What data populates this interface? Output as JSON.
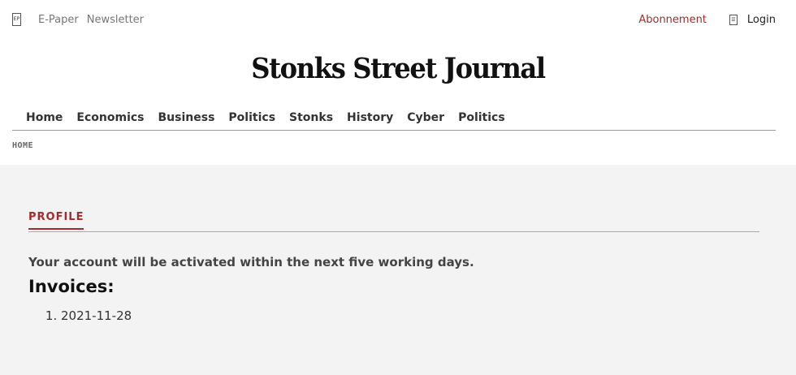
{
  "topbar": {
    "epaper_icon_glyph": "EP",
    "epaper_label": "E-Paper",
    "newsletter_label": "Newsletter",
    "subscription_label": "Abonnement",
    "login_icon_glyph": "☰",
    "login_label": "Login"
  },
  "masthead": {
    "title": "Stonks Street Journal"
  },
  "nav": {
    "items": [
      {
        "label": "Home"
      },
      {
        "label": "Economics"
      },
      {
        "label": "Business"
      },
      {
        "label": "Politics"
      },
      {
        "label": "Stonks"
      },
      {
        "label": "History"
      },
      {
        "label": "Cyber"
      },
      {
        "label": "Politics"
      }
    ]
  },
  "breadcrumb": {
    "current": "HOME"
  },
  "profile": {
    "tab_label": "PROFILE",
    "activation_message": "Your account will be activated within the next five working days.",
    "invoices_heading": "Invoices:",
    "invoices": [
      {
        "date": "2021-11-28"
      }
    ]
  },
  "colors": {
    "accent": "#a32b2b",
    "content_background": "#f3f3f3",
    "header_background": "#ffffff"
  }
}
